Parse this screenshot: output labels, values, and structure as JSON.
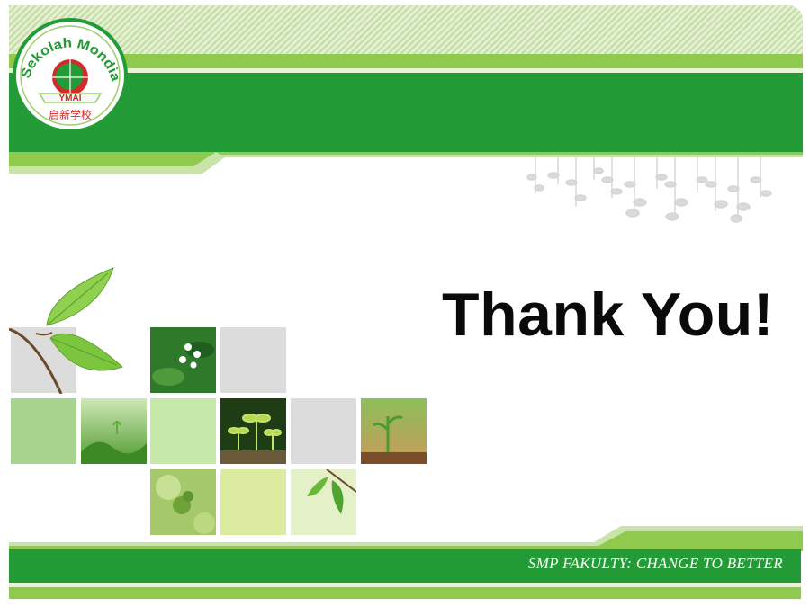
{
  "logo": {
    "text_top": "Sekolah Mondial",
    "text_banner": "YMAI",
    "text_chinese": "启新学校"
  },
  "title": "Thank You!",
  "footer": {
    "tagline": "SMP FAKULTY: CHANGE TO BETTER"
  },
  "colors": {
    "green_dark": "#239b36",
    "green_light": "#8fca4e",
    "green_pale": "#e8f3d6",
    "logo_red": "#d42a2a"
  },
  "tiles": [
    {
      "name": "tile-leaf-branch",
      "kind": "leaf-branch"
    },
    {
      "name": "tile-white-flowers",
      "kind": "photo-flowers"
    },
    {
      "name": "tile-grey-1",
      "kind": "plain-grey"
    },
    {
      "name": "tile-green-1",
      "kind": "plain-green"
    },
    {
      "name": "tile-grass",
      "kind": "photo-grass"
    },
    {
      "name": "tile-green-2",
      "kind": "plain-pale"
    },
    {
      "name": "tile-seedlings",
      "kind": "photo-seedlings"
    },
    {
      "name": "tile-grey-2",
      "kind": "plain-grey"
    },
    {
      "name": "tile-sprout",
      "kind": "photo-sprout"
    },
    {
      "name": "tile-bokeh",
      "kind": "photo-bokeh"
    },
    {
      "name": "tile-lime",
      "kind": "plain-lime"
    },
    {
      "name": "tile-leaves",
      "kind": "photo-leaves"
    }
  ]
}
